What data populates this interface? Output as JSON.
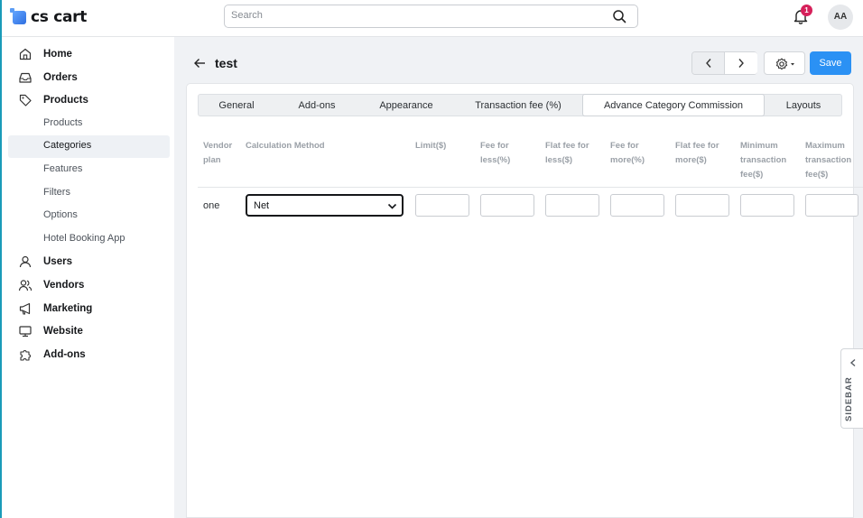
{
  "app": {
    "logo_text": "cs cart",
    "accent": "#2b91f4"
  },
  "topbar": {
    "search_placeholder": "Search",
    "notification_count": "1",
    "avatar_initials": "AA"
  },
  "sidebar": {
    "items": [
      {
        "label": "Home",
        "icon": "home-icon"
      },
      {
        "label": "Orders",
        "icon": "inbox-icon"
      },
      {
        "label": "Products",
        "icon": "tag-icon"
      },
      {
        "label": "Users",
        "icon": "user-icon"
      },
      {
        "label": "Vendors",
        "icon": "vendors-icon"
      },
      {
        "label": "Marketing",
        "icon": "megaphone-icon"
      },
      {
        "label": "Website",
        "icon": "monitor-icon"
      },
      {
        "label": "Add-ons",
        "icon": "puzzle-icon"
      }
    ],
    "products_sub": [
      "Products",
      "Categories",
      "Features",
      "Filters",
      "Options",
      "Hotel Booking App"
    ],
    "active_sub": "Categories"
  },
  "page": {
    "title": "test",
    "save_label": "Save"
  },
  "tabs": [
    "General",
    "Add-ons",
    "Appearance",
    "Transaction fee (%)",
    "Advance Category Commission",
    "Layouts"
  ],
  "active_tab": "Advance Category Commission",
  "table": {
    "headers": {
      "vendor_plan": [
        "Vendor",
        "plan"
      ],
      "calc_method": [
        "Calculation Method"
      ],
      "limit": [
        "Limit($)"
      ],
      "fee_less": [
        "Fee for",
        "less(%)"
      ],
      "flat_less": [
        "Flat fee for",
        "less($)"
      ],
      "fee_more": [
        "Fee for",
        "more(%)"
      ],
      "flat_more": [
        "Flat fee for",
        "more($)"
      ],
      "min_fee": [
        "Minimum",
        "transaction",
        "fee($)"
      ],
      "max_fee": [
        "Maximum",
        "transaction",
        "fee($)"
      ]
    },
    "row": {
      "vendor_plan": "one",
      "calc_method": "Net"
    }
  },
  "side_toggle_label": "SIDEBAR"
}
